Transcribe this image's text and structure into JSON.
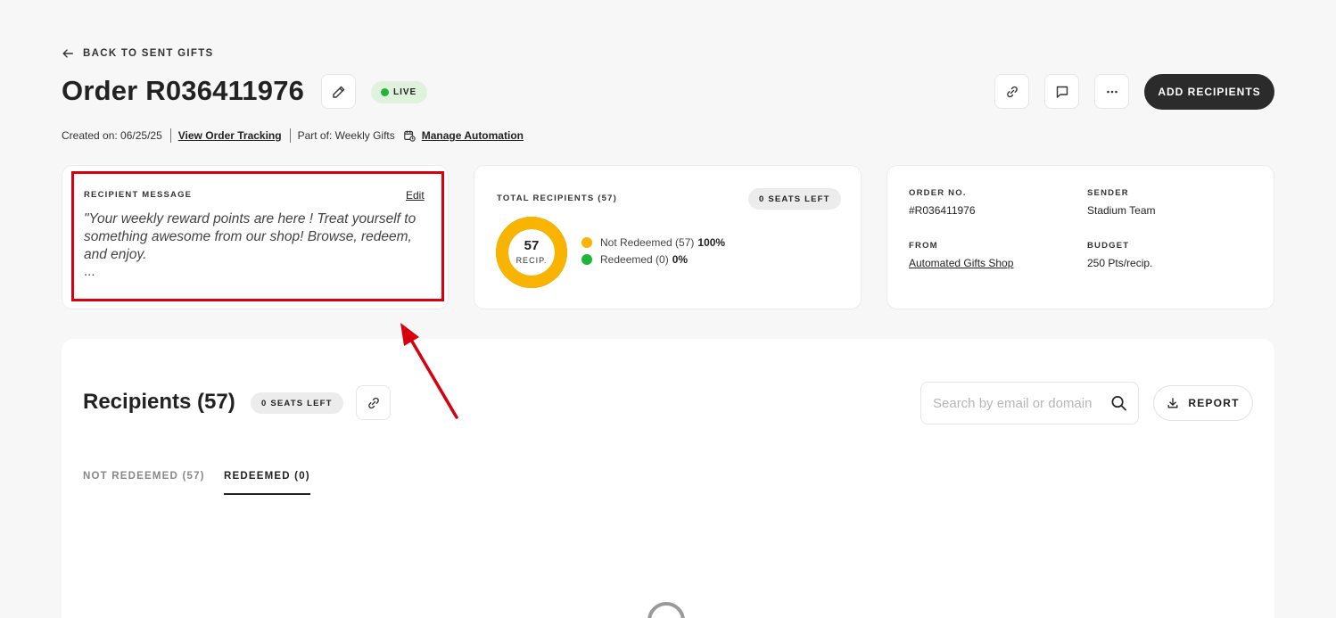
{
  "back_link": {
    "label": "BACK TO SENT GIFTS",
    "icon": "arrow-left-icon"
  },
  "order": {
    "title": "Order R036411976",
    "status": "LIVE",
    "status_color": "#22b33a",
    "add_recipients_label": "ADD RECIPIENTS"
  },
  "meta": {
    "created": "Created on: 06/25/25",
    "view_tracking": "View Order Tracking",
    "part_of": "Part of: Weekly Gifts",
    "manage_automation": "Manage Automation"
  },
  "recipient_message": {
    "label": "RECIPIENT MESSAGE",
    "edit_label": "Edit",
    "text": "\"Your weekly reward points are here ! Treat yourself to something awesome from our shop! Browse, redeem, and enjoy.",
    "ellipsis": "..."
  },
  "total_recipients": {
    "label": "TOTAL RECIPIENTS (57)",
    "seats_left": "0 SEATS LEFT",
    "count": "57",
    "count_unit": "RECIP.",
    "legend": [
      {
        "label": "Not Redeemed (57)",
        "percent": "100%",
        "color": "#f8b400"
      },
      {
        "label": "Redeemed (0)",
        "percent": "0%",
        "color": "#1db53c"
      }
    ],
    "not_redeemed_fraction": 1.0
  },
  "order_info": {
    "order_no_label": "ORDER NO.",
    "order_no": "#R036411976",
    "sender_label": "SENDER",
    "sender": "Stadium Team",
    "from_label": "FROM",
    "from": "Automated Gifts Shop",
    "budget_label": "BUDGET",
    "budget": "250 Pts/recip."
  },
  "recipients_panel": {
    "heading": "Recipients (57)",
    "seats_left": "0 SEATS LEFT",
    "search_placeholder": "Search by email or domain",
    "report_label": "REPORT",
    "tabs": [
      {
        "label": "NOT REDEEMED (57)",
        "active": false
      },
      {
        "label": "REDEEMED (0)",
        "active": true
      }
    ]
  },
  "colors": {
    "primary_button": "#2b2b2b",
    "highlight": "#d7000f",
    "live_badge_bg": "#dff3dc"
  }
}
